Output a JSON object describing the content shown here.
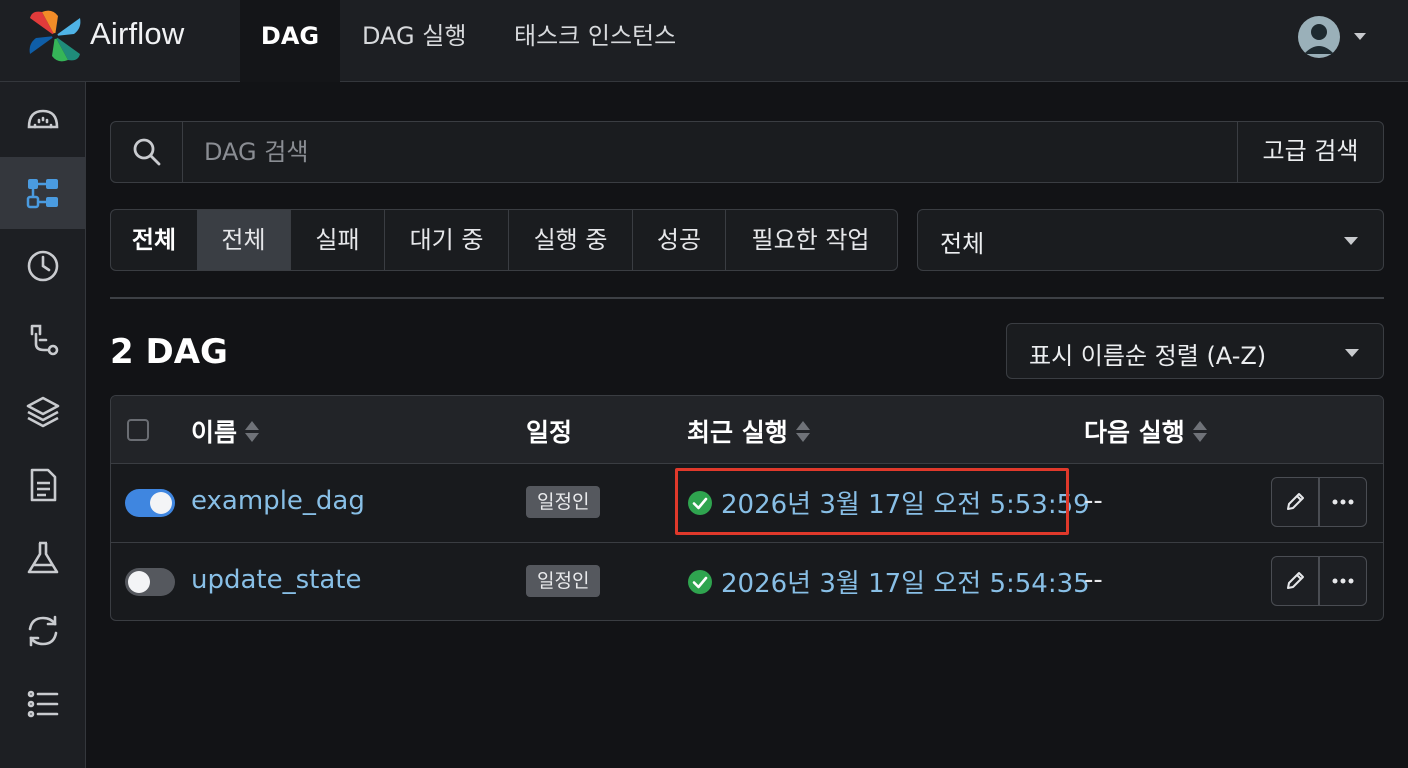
{
  "app": {
    "name": "Airflow"
  },
  "nav": {
    "tabs": [
      {
        "label": "DAG",
        "active": true
      },
      {
        "label": "DAG 실행",
        "active": false
      },
      {
        "label": "태스크 인스턴스",
        "active": false
      }
    ]
  },
  "sidebar": {
    "items": [
      {
        "icon": "dashboard-icon",
        "active": false
      },
      {
        "icon": "dag-list-icon",
        "active": true
      },
      {
        "icon": "history-icon",
        "active": false
      },
      {
        "icon": "asset-icon",
        "active": false
      },
      {
        "icon": "layers-icon",
        "active": false
      },
      {
        "icon": "document-icon",
        "active": false
      },
      {
        "icon": "flask-icon",
        "active": false
      },
      {
        "icon": "refresh-icon",
        "active": false
      },
      {
        "icon": "list-icon",
        "active": false
      }
    ]
  },
  "search": {
    "placeholder": "DAG 검색",
    "advanced_label": "고급 검색"
  },
  "filters": {
    "label": "전체",
    "buttons": [
      {
        "label": "전체",
        "active": true
      },
      {
        "label": "실패",
        "active": false
      },
      {
        "label": "대기 중",
        "active": false
      },
      {
        "label": "실행 중",
        "active": false
      },
      {
        "label": "성공",
        "active": false
      },
      {
        "label": "필요한 작업",
        "active": false
      }
    ],
    "owner_select": "전체"
  },
  "summary": {
    "count_text": "2 DAG"
  },
  "sort": {
    "selected": "표시 이름순 정렬 (A-Z)"
  },
  "table": {
    "columns": {
      "name": "이름",
      "schedule": "일정",
      "last_run": "최근 실행",
      "next_run": "다음 실행"
    },
    "rows": [
      {
        "enabled": true,
        "name": "example_dag",
        "schedule": "일정인",
        "last_run": "2026년 3월 17일 오전 5:53:59",
        "last_run_status": "success",
        "next_run": "--"
      },
      {
        "enabled": false,
        "name": "update_state",
        "schedule": "일정인",
        "last_run": "2026년 3월 17일 오전 5:54:35",
        "last_run_status": "success",
        "next_run": "--"
      }
    ]
  },
  "colors": {
    "accent_blue": "#3f86e0",
    "link_blue": "#88bfe6",
    "success_green": "#2fa44f",
    "highlight_red": "#e0392b"
  }
}
